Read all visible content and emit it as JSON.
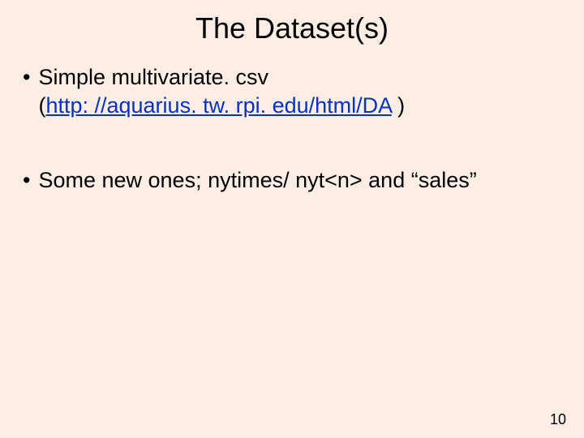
{
  "title": "The Dataset(s)",
  "bullets": {
    "b1_line1": "Simple multivariate. csv",
    "b1_prefix": "(",
    "b1_link": "http: //aquarius. tw. rpi. edu/html/DA",
    "b1_suffix": " )",
    "b2": "Some new ones; nytimes/ nyt<n> and “sales”"
  },
  "page_number": "10"
}
